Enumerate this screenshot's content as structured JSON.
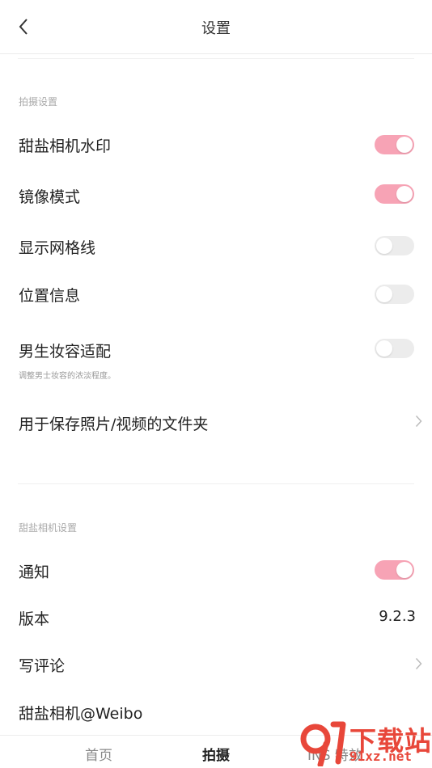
{
  "header": {
    "title": "设置"
  },
  "sections": {
    "shooting_label": "拍摄设置",
    "camera_label": "甜盐相机设置"
  },
  "rows": {
    "watermark": {
      "label": "甜盐相机水印",
      "on": true
    },
    "mirror": {
      "label": "镜像模式",
      "on": true
    },
    "grid": {
      "label": "显示网格线",
      "on": false
    },
    "location": {
      "label": "位置信息",
      "on": false
    },
    "male_makeup": {
      "label": "男生妆容适配",
      "sub": "调整男士妆容的浓淡程度。",
      "on": false
    },
    "save_folder": {
      "label": "用于保存照片/视频的文件夹"
    },
    "notification": {
      "label": "通知",
      "on": true
    },
    "version": {
      "label": "版本",
      "value": "9.2.3"
    },
    "review": {
      "label": "写评论"
    },
    "weibo": {
      "label": "甜盐相机@Weibo"
    }
  },
  "tabbar": {
    "home": "首页",
    "shoot": "拍摄",
    "ins": "INS 特效"
  },
  "watermark_overlay": {
    "big": "下载站",
    "url": "91xz.net",
    "color": "#e8473a"
  },
  "colors": {
    "toggle_on": "#f7a3b5",
    "toggle_off": "#ececec"
  }
}
